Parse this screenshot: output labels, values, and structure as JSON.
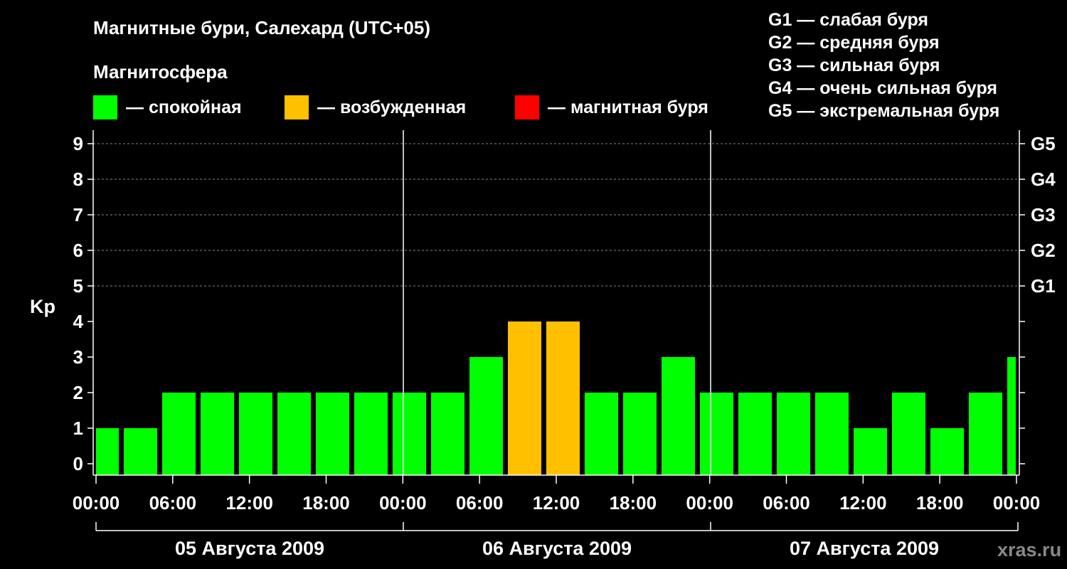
{
  "title": "Магнитные бури, Салехард (UTC+05)",
  "subtitle": "Магнитосфера",
  "legend": [
    {
      "label": "— спокойная",
      "color": "#00ff00"
    },
    {
      "label": "— возбужденная",
      "color": "#ffc000"
    },
    {
      "label": "— магнитная буря",
      "color": "#ff0000"
    }
  ],
  "g_legend": [
    "G1 — слабая буря",
    "G2 — средняя буря",
    "G3 — сильная буря",
    "G4 — очень сильная буря",
    "G5 — экстремальная буря"
  ],
  "watermark": "xras.ru",
  "chart_data": {
    "type": "bar",
    "ylabel": "Kp",
    "ylim": [
      0,
      9
    ],
    "yticks": [
      "0",
      "1",
      "2",
      "3",
      "4",
      "5",
      "6",
      "7",
      "8",
      "9"
    ],
    "right_ticks": [
      {
        "value": 5,
        "label": "G1"
      },
      {
        "value": 6,
        "label": "G2"
      },
      {
        "value": 7,
        "label": "G3"
      },
      {
        "value": 8,
        "label": "G4"
      },
      {
        "value": 9,
        "label": "G5"
      }
    ],
    "xtick_labels": [
      "00:00",
      "06:00",
      "12:00",
      "18:00",
      "00:00",
      "06:00",
      "12:00",
      "18:00",
      "00:00",
      "06:00",
      "12:00",
      "18:00",
      "00:00"
    ],
    "dates": [
      "05 Августа 2009",
      "06 Августа 2009",
      "07 Августа 2009"
    ],
    "interval_hours": 3,
    "values": [
      1,
      1,
      2,
      2,
      2,
      2,
      2,
      2,
      2,
      2,
      3,
      4,
      4,
      2,
      2,
      3,
      2,
      2,
      2,
      2,
      1,
      2,
      1,
      2,
      3
    ],
    "colors": {
      "calm": "#00ff00",
      "disturbed": "#ffc000",
      "storm": "#ff0000"
    },
    "grid": true
  }
}
